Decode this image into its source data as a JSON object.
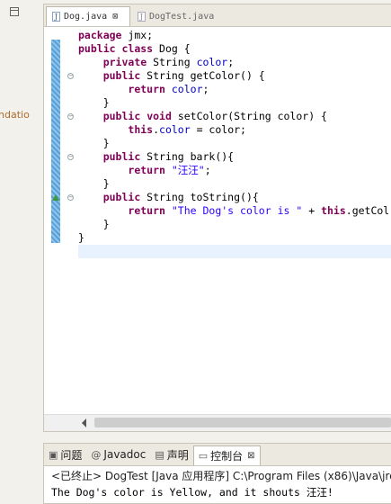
{
  "left_panel": {
    "fragment_text": "ndatio"
  },
  "editor": {
    "tabs": [
      {
        "label": "Dog.java",
        "active": true,
        "close": "⊠"
      },
      {
        "label": "DogTest.java",
        "active": false
      }
    ],
    "code_lines": [
      "package jmx;",
      "public class Dog {",
      "    private String color;",
      "    public String getColor() {",
      "        return color;",
      "    }",
      "    public void setColor(String color) {",
      "        this.color = color;",
      "    }",
      "    public String bark(){",
      "        return \"汪汪\";",
      "    }",
      "    public String toString(){",
      "        return \"The Dog's color is \" + this.getCol",
      "    }",
      "}"
    ]
  },
  "console": {
    "tabs": [
      {
        "label": "问题",
        "icon": "problems-icon"
      },
      {
        "label": "Javadoc",
        "icon": "javadoc-icon"
      },
      {
        "label": "声明",
        "icon": "declaration-icon"
      },
      {
        "label": "控制台",
        "icon": "console-icon",
        "active": true,
        "close": "⊠"
      }
    ],
    "header": "<已终止> DogTest [Java 应用程序] C:\\Program Files (x86)\\Java\\jre",
    "output": "The Dog's color is Yellow, and it shouts 汪汪!"
  },
  "colors": {
    "keyword": "#7f0055",
    "field": "#0000c0",
    "string": "#2a00ff",
    "change_ruler": "#5aa0d8"
  }
}
